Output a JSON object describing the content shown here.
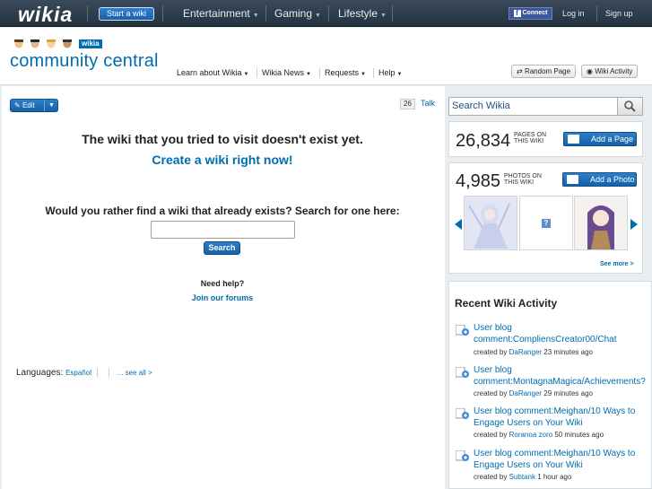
{
  "topbar": {
    "logo": "wikia",
    "start_wiki": "Start a wiki",
    "nav": [
      {
        "label": "Entertainment"
      },
      {
        "label": "Gaming"
      },
      {
        "label": "Lifestyle"
      }
    ],
    "connect": "Connect",
    "login": "Log in",
    "signup": "Sign up"
  },
  "header": {
    "badge": "wikia",
    "site_title": "community central",
    "nav": [
      {
        "label": "Learn about Wikia"
      },
      {
        "label": "Wikia News"
      },
      {
        "label": "Requests"
      },
      {
        "label": "Help"
      }
    ],
    "random_page": "Random Page",
    "wiki_activity": "Wiki Activity"
  },
  "page": {
    "edit_label": "Edit",
    "talk_count": "26",
    "talk_label": "Talk",
    "message": "The wiki that you tried to visit doesn't exist yet.",
    "create_link": "Create a wiki right now!",
    "search_prompt": "Would you rather find a wiki that already exists? Search for one here:",
    "search_value": "",
    "search_button": "Search",
    "need_help": "Need help?",
    "forums_link": "Join our forums",
    "languages_label": "Languages:",
    "language_link": "Español",
    "see_all": "... see all >"
  },
  "rail": {
    "search_placeholder": "Search Wikia",
    "pages_count": "26,834",
    "pages_label_1": "PAGES ON",
    "pages_label_2": "THIS WIKI",
    "add_page": "Add a Page",
    "photos_count": "4,985",
    "photos_label_1": "PHOTOS ON",
    "photos_label_2": "THIS WIKI",
    "add_photo": "Add a Photo",
    "placeholder_thumb": "?",
    "see_more": "See more >",
    "activity_title": "Recent Wiki Activity",
    "activity": [
      {
        "title": "User blog comment:CompliensCreator00/Chat",
        "created_by": "created by",
        "user": "DaRanger",
        "time": "23 minutes ago"
      },
      {
        "title": "User blog comment:MontagnaMagica/Achievements?",
        "created_by": "created by",
        "user": "DaRanger",
        "time": "29 minutes ago"
      },
      {
        "title": "User blog comment:Meighan/10 Ways to Engage Users on Your Wiki",
        "created_by": "created by",
        "user": "Roranoa zoro",
        "time": "50 minutes ago"
      },
      {
        "title": "User blog comment:Meighan/10 Ways to Engage Users on Your Wiki",
        "created_by": "created by",
        "user": "Subtank",
        "time": "1 hour ago"
      }
    ]
  },
  "colors": {
    "link_blue": "#006cb0",
    "button_blue": "#1d6dbd",
    "topbar": "#2d3c4b"
  }
}
